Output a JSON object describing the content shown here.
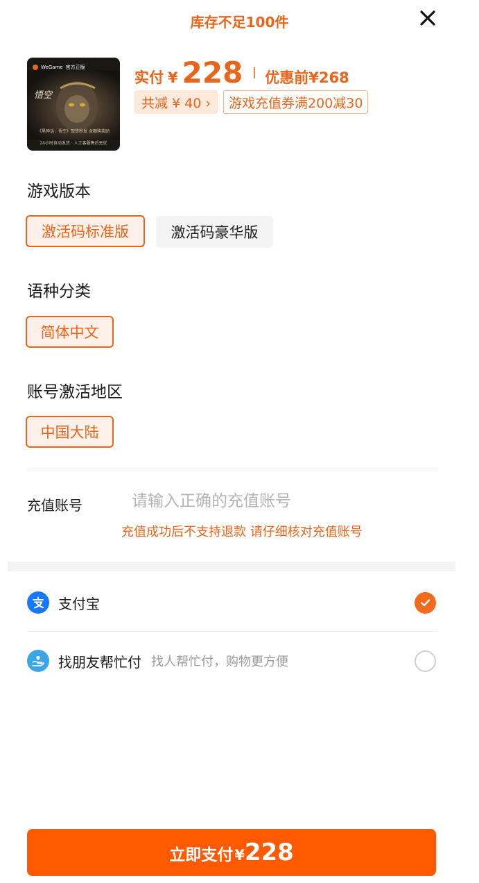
{
  "header": {
    "stock_notice": "库存不足100件"
  },
  "product": {
    "thumbnail": {
      "brand": "WeGame",
      "official_tag": "官方正版",
      "caption_line1": "《黑神话：悟空》现货秒发 含额购奖励",
      "caption_line2": "24小时自动发货 · 人工客服售后无忧"
    },
    "pay_label": "实付",
    "currency": "¥",
    "price": "228",
    "original_label": "优惠前¥268",
    "discount_badge": "共减 ¥ 40 ›",
    "coupon_badge": "游戏充值券满200减30"
  },
  "options": {
    "version": {
      "title": "游戏版本",
      "choices": [
        {
          "label": "激活码标准版",
          "selected": true
        },
        {
          "label": "激活码豪华版",
          "selected": false
        }
      ]
    },
    "language": {
      "title": "语种分类",
      "choices": [
        {
          "label": "简体中文",
          "selected": true
        }
      ]
    },
    "region": {
      "title": "账号激活地区",
      "choices": [
        {
          "label": "中国大陆",
          "selected": true
        }
      ]
    }
  },
  "account": {
    "label": "充值账号",
    "placeholder": "请输入正确的充值账号",
    "value": "",
    "warning": "充值成功后不支持退款 请仔细核对充值账号"
  },
  "payment_methods": [
    {
      "name": "支付宝",
      "subtitle": "",
      "selected": true,
      "icon": "alipay-icon"
    },
    {
      "name": "找朋友帮忙付",
      "subtitle": "找人帮忙付，购物更方便",
      "selected": false,
      "icon": "friend-pay-icon"
    }
  ],
  "footer": {
    "pay_button_label": "立即支付",
    "currency": "¥",
    "amount": "228"
  },
  "colors": {
    "accent": "#e8651c",
    "button": "#ff5a00",
    "alipay_blue": "#1677ff",
    "friend_pay_blue": "#3aa6e8"
  }
}
